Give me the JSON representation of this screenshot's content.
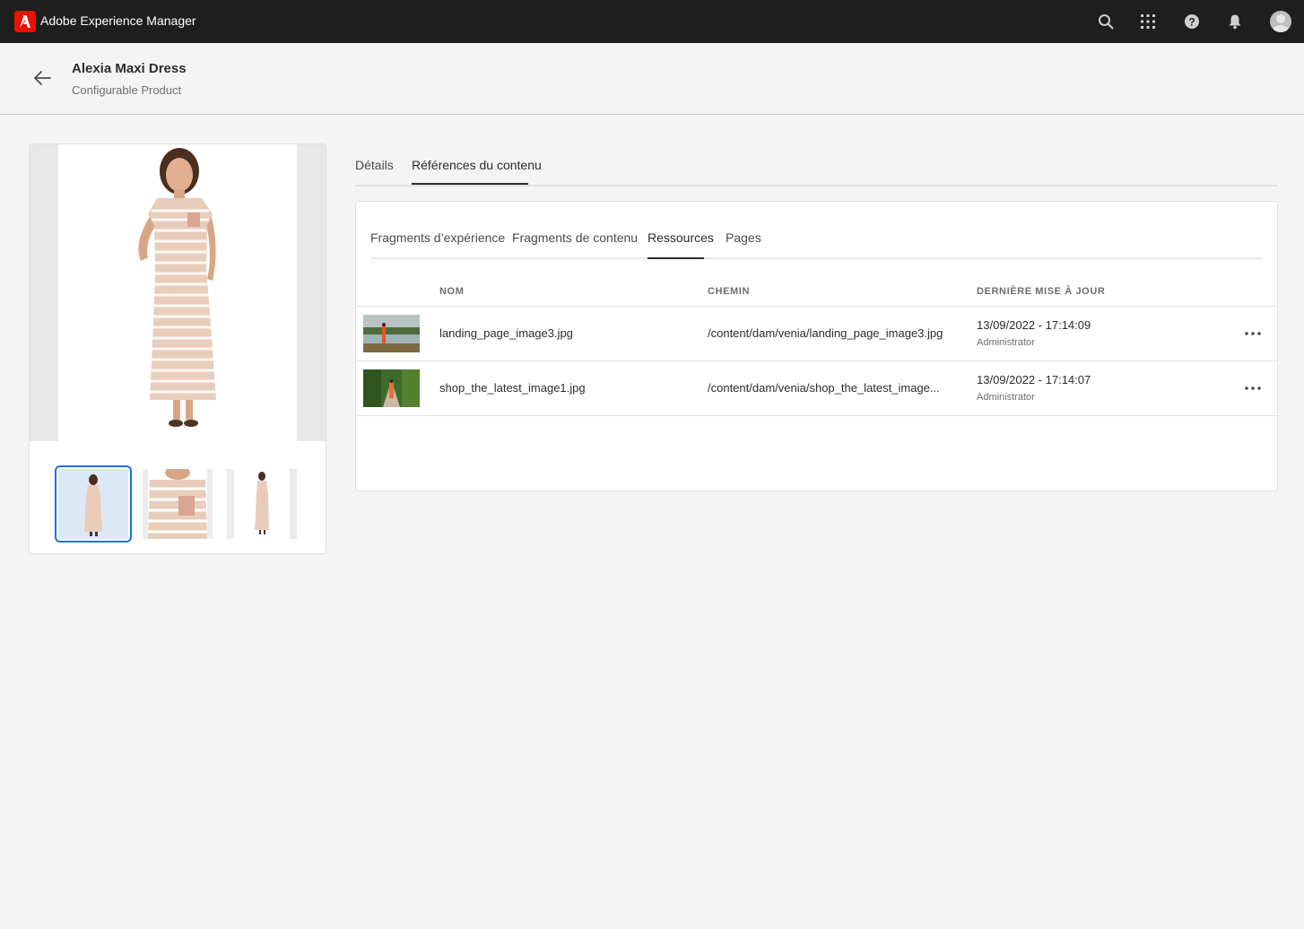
{
  "app": {
    "title": "Adobe Experience Manager",
    "accent_color": "#eb1000",
    "icons": [
      "search-icon",
      "apps-icon",
      "help-icon",
      "bell-icon",
      "user-avatar"
    ]
  },
  "header": {
    "title": "Alexia Maxi Dress",
    "subtitle": "Configurable Product"
  },
  "tabs": [
    {
      "label": "Détails",
      "active": false
    },
    {
      "label": "Références du contenu",
      "active": true
    }
  ],
  "subtabs": [
    {
      "label": "Fragments d’expérience",
      "active": false
    },
    {
      "label": "Fragments de contenu",
      "active": false
    },
    {
      "label": "Ressources",
      "active": true
    },
    {
      "label": "Pages",
      "active": false
    }
  ],
  "table": {
    "columns": [
      "NOM",
      "CHEMIN",
      "DERNIÈRE MISE À JOUR"
    ],
    "rows": [
      {
        "name": "landing_page_image3.jpg",
        "path": "/content/dam/venia/landing_page_image3.jpg",
        "updated": "13/09/2022 - 17:14:09",
        "user": "Administrator"
      },
      {
        "name": "shop_the_latest_image1.jpg",
        "path": "/content/dam/venia/shop_the_latest_image...",
        "updated": "13/09/2022 - 17:14:07",
        "user": "Administrator"
      }
    ]
  },
  "product_images": {
    "selected_index": 0,
    "count": 3
  }
}
